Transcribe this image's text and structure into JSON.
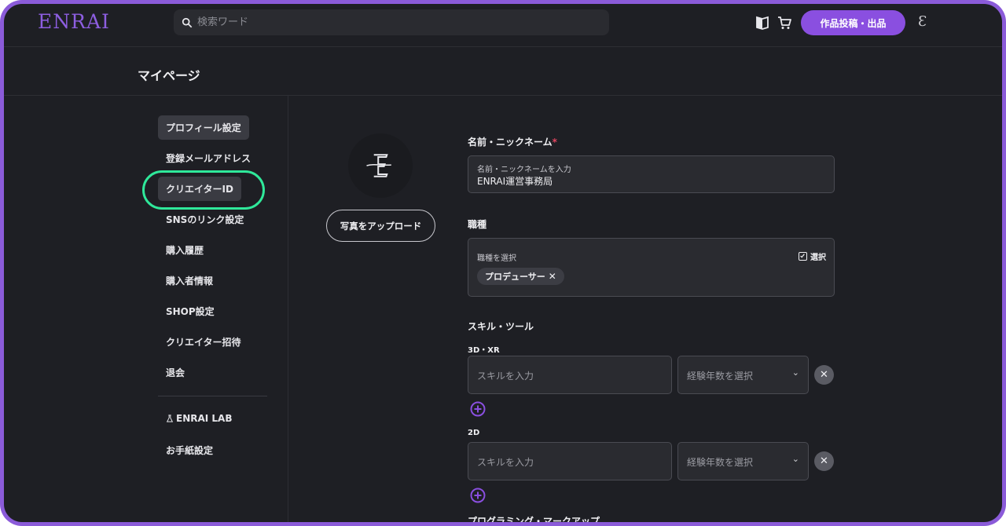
{
  "header": {
    "logo": "ENRAI",
    "search_placeholder": "検索ワード",
    "post_button": "作品投稿・出品",
    "user_mark": "Ɛ",
    "icons": [
      "book-icon",
      "cart-icon"
    ]
  },
  "page": {
    "title": "マイページ"
  },
  "sidebar": {
    "items": [
      {
        "label": "プロフィール設定",
        "active": true
      },
      {
        "label": "登録メールアドレス"
      },
      {
        "label": "クリエイターID",
        "highlighted": true
      },
      {
        "label": "SNSのリンク設定"
      },
      {
        "label": "購入履歴"
      },
      {
        "label": "購入者情報"
      },
      {
        "label": "SHOP設定"
      },
      {
        "label": "クリエイター招待"
      },
      {
        "label": "退会"
      }
    ],
    "extra": [
      {
        "label": "ENRAI LAB",
        "icon": "flask-icon"
      },
      {
        "label": "お手紙設定"
      }
    ]
  },
  "profile": {
    "upload_button": "写真をアップロード"
  },
  "form": {
    "name": {
      "label": "名前・ニックネーム",
      "required_mark": "*",
      "field_label": "名前・ニックネームを入力",
      "value": "ENRAI運営事務局"
    },
    "job": {
      "label": "職種",
      "field_label": "職種を選択",
      "select_label": "選択",
      "chip": "プロデューサー",
      "chip_remove": "✕"
    },
    "skills": {
      "label": "スキル・ツール",
      "groups": [
        {
          "label": "3D・XR",
          "skill_placeholder": "スキルを入力",
          "years_placeholder": "経験年数を選択"
        },
        {
          "label": "2D",
          "skill_placeholder": "スキルを入力",
          "years_placeholder": "経験年数を選択"
        }
      ],
      "next_group_label": "プログラミング・マークアップ"
    }
  },
  "colors": {
    "accent": "#8a4fe0",
    "background": "#1e1f24",
    "highlight": "#2fe89a"
  }
}
